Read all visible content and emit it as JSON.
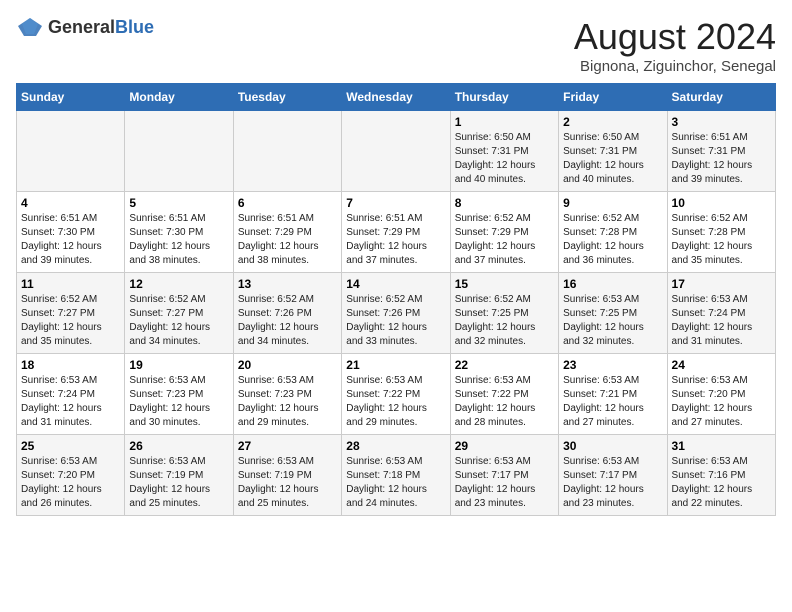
{
  "header": {
    "logo_general": "General",
    "logo_blue": "Blue",
    "month_year": "August 2024",
    "location": "Bignona, Ziguinchor, Senegal"
  },
  "days_of_week": [
    "Sunday",
    "Monday",
    "Tuesday",
    "Wednesday",
    "Thursday",
    "Friday",
    "Saturday"
  ],
  "weeks": [
    [
      {
        "day": "",
        "info": ""
      },
      {
        "day": "",
        "info": ""
      },
      {
        "day": "",
        "info": ""
      },
      {
        "day": "",
        "info": ""
      },
      {
        "day": "1",
        "info": "Sunrise: 6:50 AM\nSunset: 7:31 PM\nDaylight: 12 hours\nand 40 minutes."
      },
      {
        "day": "2",
        "info": "Sunrise: 6:50 AM\nSunset: 7:31 PM\nDaylight: 12 hours\nand 40 minutes."
      },
      {
        "day": "3",
        "info": "Sunrise: 6:51 AM\nSunset: 7:31 PM\nDaylight: 12 hours\nand 39 minutes."
      }
    ],
    [
      {
        "day": "4",
        "info": "Sunrise: 6:51 AM\nSunset: 7:30 PM\nDaylight: 12 hours\nand 39 minutes."
      },
      {
        "day": "5",
        "info": "Sunrise: 6:51 AM\nSunset: 7:30 PM\nDaylight: 12 hours\nand 38 minutes."
      },
      {
        "day": "6",
        "info": "Sunrise: 6:51 AM\nSunset: 7:29 PM\nDaylight: 12 hours\nand 38 minutes."
      },
      {
        "day": "7",
        "info": "Sunrise: 6:51 AM\nSunset: 7:29 PM\nDaylight: 12 hours\nand 37 minutes."
      },
      {
        "day": "8",
        "info": "Sunrise: 6:52 AM\nSunset: 7:29 PM\nDaylight: 12 hours\nand 37 minutes."
      },
      {
        "day": "9",
        "info": "Sunrise: 6:52 AM\nSunset: 7:28 PM\nDaylight: 12 hours\nand 36 minutes."
      },
      {
        "day": "10",
        "info": "Sunrise: 6:52 AM\nSunset: 7:28 PM\nDaylight: 12 hours\nand 35 minutes."
      }
    ],
    [
      {
        "day": "11",
        "info": "Sunrise: 6:52 AM\nSunset: 7:27 PM\nDaylight: 12 hours\nand 35 minutes."
      },
      {
        "day": "12",
        "info": "Sunrise: 6:52 AM\nSunset: 7:27 PM\nDaylight: 12 hours\nand 34 minutes."
      },
      {
        "day": "13",
        "info": "Sunrise: 6:52 AM\nSunset: 7:26 PM\nDaylight: 12 hours\nand 34 minutes."
      },
      {
        "day": "14",
        "info": "Sunrise: 6:52 AM\nSunset: 7:26 PM\nDaylight: 12 hours\nand 33 minutes."
      },
      {
        "day": "15",
        "info": "Sunrise: 6:52 AM\nSunset: 7:25 PM\nDaylight: 12 hours\nand 32 minutes."
      },
      {
        "day": "16",
        "info": "Sunrise: 6:53 AM\nSunset: 7:25 PM\nDaylight: 12 hours\nand 32 minutes."
      },
      {
        "day": "17",
        "info": "Sunrise: 6:53 AM\nSunset: 7:24 PM\nDaylight: 12 hours\nand 31 minutes."
      }
    ],
    [
      {
        "day": "18",
        "info": "Sunrise: 6:53 AM\nSunset: 7:24 PM\nDaylight: 12 hours\nand 31 minutes."
      },
      {
        "day": "19",
        "info": "Sunrise: 6:53 AM\nSunset: 7:23 PM\nDaylight: 12 hours\nand 30 minutes."
      },
      {
        "day": "20",
        "info": "Sunrise: 6:53 AM\nSunset: 7:23 PM\nDaylight: 12 hours\nand 29 minutes."
      },
      {
        "day": "21",
        "info": "Sunrise: 6:53 AM\nSunset: 7:22 PM\nDaylight: 12 hours\nand 29 minutes."
      },
      {
        "day": "22",
        "info": "Sunrise: 6:53 AM\nSunset: 7:22 PM\nDaylight: 12 hours\nand 28 minutes."
      },
      {
        "day": "23",
        "info": "Sunrise: 6:53 AM\nSunset: 7:21 PM\nDaylight: 12 hours\nand 27 minutes."
      },
      {
        "day": "24",
        "info": "Sunrise: 6:53 AM\nSunset: 7:20 PM\nDaylight: 12 hours\nand 27 minutes."
      }
    ],
    [
      {
        "day": "25",
        "info": "Sunrise: 6:53 AM\nSunset: 7:20 PM\nDaylight: 12 hours\nand 26 minutes."
      },
      {
        "day": "26",
        "info": "Sunrise: 6:53 AM\nSunset: 7:19 PM\nDaylight: 12 hours\nand 25 minutes."
      },
      {
        "day": "27",
        "info": "Sunrise: 6:53 AM\nSunset: 7:19 PM\nDaylight: 12 hours\nand 25 minutes."
      },
      {
        "day": "28",
        "info": "Sunrise: 6:53 AM\nSunset: 7:18 PM\nDaylight: 12 hours\nand 24 minutes."
      },
      {
        "day": "29",
        "info": "Sunrise: 6:53 AM\nSunset: 7:17 PM\nDaylight: 12 hours\nand 23 minutes."
      },
      {
        "day": "30",
        "info": "Sunrise: 6:53 AM\nSunset: 7:17 PM\nDaylight: 12 hours\nand 23 minutes."
      },
      {
        "day": "31",
        "info": "Sunrise: 6:53 AM\nSunset: 7:16 PM\nDaylight: 12 hours\nand 22 minutes."
      }
    ]
  ]
}
